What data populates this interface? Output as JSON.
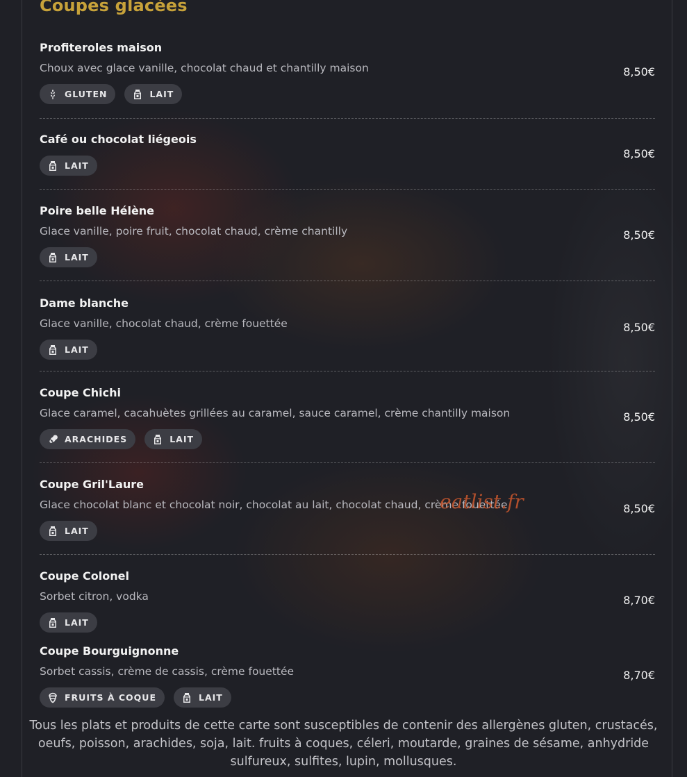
{
  "section": {
    "title": "Coupes glacées"
  },
  "items": [
    {
      "name": "Profiteroles maison",
      "desc": "Choux avec glace vanille, chocolat chaud et chantilly maison",
      "price": "8,50€",
      "tags": [
        {
          "label": "GLUTEN",
          "icon": "wheat-icon"
        },
        {
          "label": "LAIT",
          "icon": "milk-icon"
        }
      ]
    },
    {
      "name": "Café ou chocolat liégeois",
      "desc": "",
      "price": "8,50€",
      "tags": [
        {
          "label": "LAIT",
          "icon": "milk-icon"
        }
      ]
    },
    {
      "name": "Poire belle Hélène",
      "desc": "Glace vanille, poire fruit, chocolat chaud, crème chantilly",
      "price": "8,50€",
      "tags": [
        {
          "label": "LAIT",
          "icon": "milk-icon"
        }
      ]
    },
    {
      "name": "Dame blanche",
      "desc": "Glace vanille, chocolat chaud, crème fouettée",
      "price": "8,50€",
      "tags": [
        {
          "label": "LAIT",
          "icon": "milk-icon"
        }
      ]
    },
    {
      "name": "Coupe Chichi",
      "desc": "Glace caramel, cacahuètes grillées au caramel, sauce caramel, crème chantilly maison",
      "price": "8,50€",
      "tags": [
        {
          "label": "ARACHIDES",
          "icon": "peanut-icon"
        },
        {
          "label": "LAIT",
          "icon": "milk-icon"
        }
      ]
    },
    {
      "name": "Coupe Gril'Laure",
      "desc": "Glace chocolat blanc et chocolat noir, chocolat au lait, chocolat chaud, crème fouettée",
      "price": "8,50€",
      "tags": [
        {
          "label": "LAIT",
          "icon": "milk-icon"
        }
      ]
    },
    {
      "name": "Coupe Colonel",
      "desc": "Sorbet citron, vodka",
      "price": "8,70€",
      "tags": [
        {
          "label": "LAIT",
          "icon": "milk-icon"
        }
      ]
    },
    {
      "name": "Coupe Bourguignonne",
      "desc": "Sorbet cassis, crème de cassis, crème fouettée",
      "price": "8,70€",
      "tags": [
        {
          "label": "FRUITS À COQUE",
          "icon": "nut-icon"
        },
        {
          "label": "LAIT",
          "icon": "milk-icon"
        }
      ]
    }
  ],
  "watermark": "eatlist.fr",
  "footer_note": "Tous les plats et produits de cette carte sont susceptibles de contenir des allergènes gluten, crustacés, oeufs, poisson, arachides, soja, lait. fruits à coques, céleri, moutarde, graines de sésame, anhydride sulfureux, sulfites, lupin, mollusques.",
  "colors": {
    "accent": "#c7a23a",
    "background": "#1f2026",
    "tag_bg": "#3c3d44",
    "watermark": "#c0542d"
  }
}
